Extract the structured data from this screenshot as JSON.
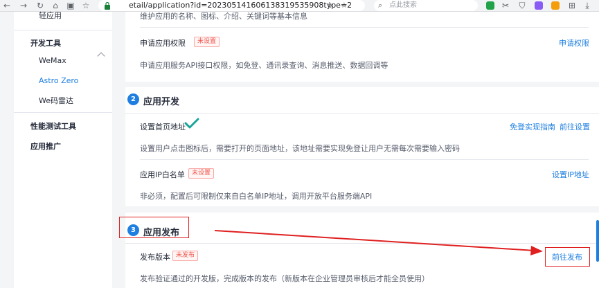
{
  "browser": {
    "url": "etail/application?id=202305141606138319535908type=2",
    "search_placeholder": "点此搜索"
  },
  "sidebar": {
    "truncated_item": "轻应用",
    "groups": [
      {
        "label": "开发工具",
        "items": [
          "WeMax",
          "Astro Zero",
          "We码雷达"
        ],
        "active": "Astro Zero"
      },
      {
        "label": "性能测试工具"
      },
      {
        "label": "应用推广"
      }
    ]
  },
  "basic": {
    "truncated_desc": "维护应用的名称、图标、介绍、关键词等基本信息",
    "permission": {
      "title": "申请应用权限",
      "tag": "未设置",
      "link": "申请权限",
      "desc": "申请应用服务API接口权限，如免登、通讯录查询、消息推送、数据回调等"
    }
  },
  "dev": {
    "step": "2",
    "title": "应用开发",
    "homepage": {
      "title": "设置首页地址",
      "link_guide": "免登实现指南",
      "link_setup": "前往设置",
      "desc": "设置用户点击图标后，需要打开的页面地址，该地址需要实现免登让用户无需每次需要输入密码"
    },
    "ip": {
      "title": "应用IP白名单",
      "tag": "未设置",
      "link": "设置IP地址",
      "desc": "非必须，配置后可限制仅来自白名单IP地址，调用开放平台服务端API"
    }
  },
  "publish": {
    "step": "3",
    "title": "应用发布",
    "version": {
      "title": "发布版本",
      "tag": "未发布",
      "link": "前往发布",
      "desc": "发布验证通过的开发版，完成版本的发布（新版本在企业管理员审核后才能全员使用）"
    }
  },
  "colors": {
    "accent": "#1e7fe0",
    "tag_red": "#f0564d",
    "annotation_red": "#e02020",
    "check_green": "#1aa59a"
  }
}
